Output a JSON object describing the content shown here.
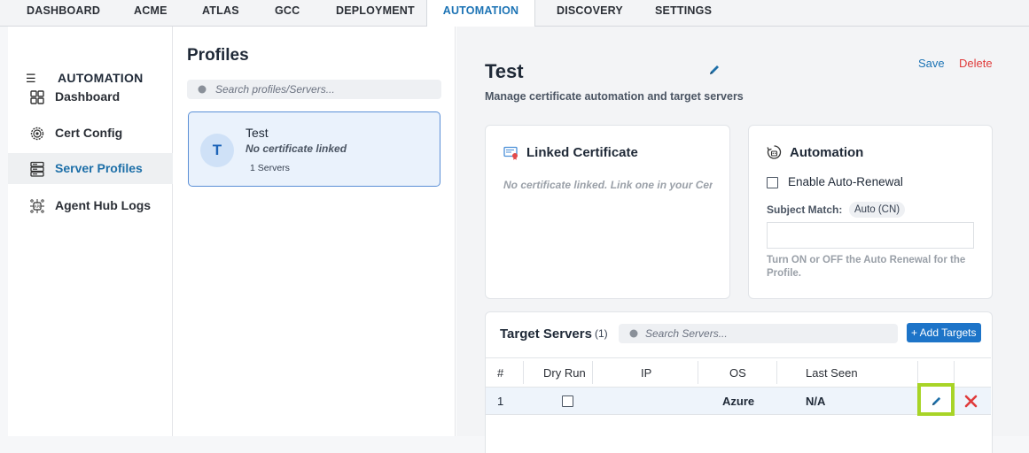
{
  "topnav": {
    "tabs": [
      {
        "label": "DASHBOARD"
      },
      {
        "label": "ACME"
      },
      {
        "label": "ATLAS"
      },
      {
        "label": "GCC"
      },
      {
        "label": "DEPLOYMENT"
      },
      {
        "label": "AUTOMATION",
        "active": true
      },
      {
        "label": "DISCOVERY"
      },
      {
        "label": "SETTINGS"
      }
    ]
  },
  "sidebar": {
    "title": "AUTOMATION",
    "items": [
      {
        "label": "Dashboard",
        "icon": "grid-icon"
      },
      {
        "label": "Cert Config",
        "icon": "gear-icon"
      },
      {
        "label": "Server Profiles",
        "icon": "server-icon",
        "active": true
      },
      {
        "label": "Agent Hub Logs",
        "icon": "api-hub-icon"
      }
    ]
  },
  "profiles": {
    "heading": "Profiles",
    "search_placeholder": "Search profiles/Servers...",
    "items": [
      {
        "initial": "T",
        "name": "Test",
        "certificate": "No certificate linked",
        "servers": "1 Servers"
      }
    ]
  },
  "detail": {
    "title": "Test",
    "subtitle": "Manage certificate automation and target servers",
    "save_label": "Save",
    "delete_label": "Delete",
    "linked_certificate": {
      "heading": "Linked Certificate",
      "empty_text": "No certificate linked. Link one in your Cer"
    },
    "automation": {
      "heading": "Automation",
      "auto_renewal_label": "Enable Auto-Renewal",
      "auto_renewal_checked": false,
      "subject_match_label": "Subject Match:",
      "subject_match_value": "Auto (CN)",
      "help_text": "Turn ON or OFF the Auto Renewal for the Profile."
    },
    "targets": {
      "heading": "Target Servers",
      "count": "(1)",
      "search_placeholder": "Search Servers...",
      "add_label": "+ Add Targets",
      "columns": [
        "#",
        "Dry Run",
        "IP",
        "OS",
        "Last Seen"
      ],
      "rows": [
        {
          "index": "1",
          "dry_run": false,
          "ip": "",
          "os": "Azure",
          "last_seen": "N/A"
        }
      ]
    }
  },
  "colors": {
    "accent": "#1d74b5",
    "danger": "#e03b3b",
    "highlight": "#a8d427"
  }
}
